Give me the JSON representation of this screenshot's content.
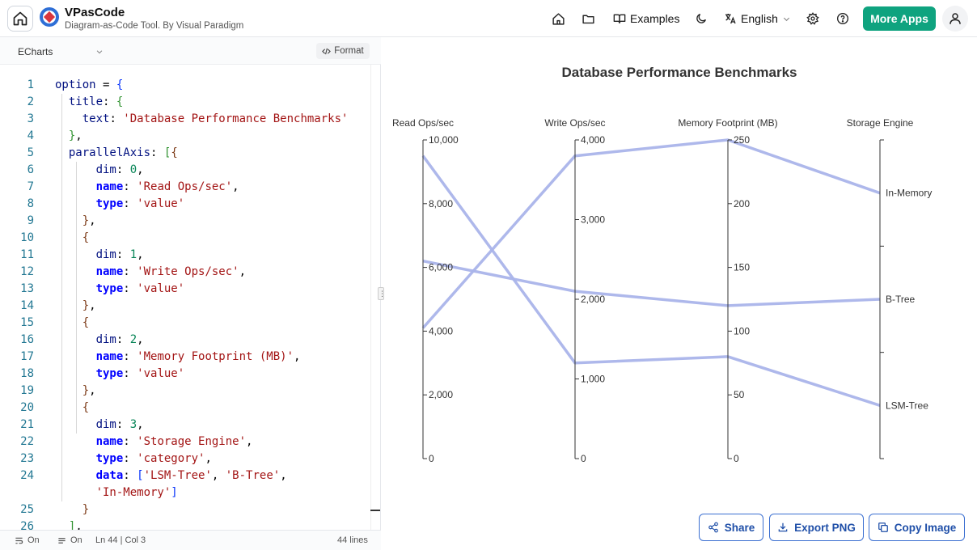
{
  "header": {
    "app_name": "VPasCode",
    "app_subtitle": "Diagram-as-Code Tool. By Visual Paradigm",
    "examples_label": "Examples",
    "language_label": "English",
    "more_apps_label": "More Apps",
    "brand_color": "#0fa37f"
  },
  "editor": {
    "library": "ECharts",
    "format_label": "Format",
    "lines": [
      {
        "n": "1",
        "html": "<span class='k'>option</span> = <span class='b1'>{</span>"
      },
      {
        "n": "2",
        "html": "  <span class='k'>title</span>: <span class='b2'>{</span>"
      },
      {
        "n": "3",
        "html": "    <span class='k'>text</span>: <span class='s'>'Database Performance Benchmarks'</span>"
      },
      {
        "n": "4",
        "html": "  <span class='b2'>}</span>,"
      },
      {
        "n": "5",
        "html": "  <span class='k'>parallelAxis</span>: <span class='b2'>[</span><span class='b3'>{</span>"
      },
      {
        "n": "6",
        "html": "      <span class='k'>dim</span>: <span class='n'>0</span>,"
      },
      {
        "n": "7",
        "html": "      <span class='kb'>name</span>: <span class='s'>'Read Ops/sec'</span>,"
      },
      {
        "n": "8",
        "html": "      <span class='kb'>type</span>: <span class='s'>'value'</span>"
      },
      {
        "n": "9",
        "html": "    <span class='b3'>}</span>,"
      },
      {
        "n": "10",
        "html": "    <span class='b3'>{</span>"
      },
      {
        "n": "11",
        "html": "      <span class='k'>dim</span>: <span class='n'>1</span>,"
      },
      {
        "n": "12",
        "html": "      <span class='kb'>name</span>: <span class='s'>'Write Ops/sec'</span>,"
      },
      {
        "n": "13",
        "html": "      <span class='kb'>type</span>: <span class='s'>'value'</span>"
      },
      {
        "n": "14",
        "html": "    <span class='b3'>}</span>,"
      },
      {
        "n": "15",
        "html": "    <span class='b3'>{</span>"
      },
      {
        "n": "16",
        "html": "      <span class='k'>dim</span>: <span class='n'>2</span>,"
      },
      {
        "n": "17",
        "html": "      <span class='kb'>name</span>: <span class='s'>'Memory Footprint (MB)'</span>,"
      },
      {
        "n": "18",
        "html": "      <span class='kb'>type</span>: <span class='s'>'value'</span>"
      },
      {
        "n": "19",
        "html": "    <span class='b3'>}</span>,"
      },
      {
        "n": "20",
        "html": "    <span class='b3'>{</span>"
      },
      {
        "n": "21",
        "html": "      <span class='k'>dim</span>: <span class='n'>3</span>,"
      },
      {
        "n": "22",
        "html": "      <span class='kb'>name</span>: <span class='s'>'Storage Engine'</span>,"
      },
      {
        "n": "23",
        "html": "      <span class='kb'>type</span>: <span class='s'>'category'</span>,"
      },
      {
        "n": "24",
        "html": "      <span class='kb'>data</span>: <span class='b1'>[</span><span class='s'>'LSM-Tree'</span>, <span class='s'>'B-Tree'</span>,"
      },
      {
        "n": "",
        "html": "      <span class='s'>'In-Memory'</span><span class='b1'>]</span>"
      },
      {
        "n": "25",
        "html": "    <span class='b3'>}</span>"
      },
      {
        "n": "26",
        "html": "  <span class='b2'>]</span>,"
      }
    ]
  },
  "status": {
    "wrap": "On",
    "minimap": "On",
    "cursor": "Ln 44 | Col 3",
    "total_lines": "44 lines"
  },
  "actions": {
    "share": "Share",
    "export_png": "Export PNG",
    "copy_image": "Copy Image"
  },
  "chart_data": {
    "type": "parallel",
    "title": "Database Performance Benchmarks",
    "axes": [
      {
        "name": "Read Ops/sec",
        "type": "value",
        "min": 0,
        "max": 10000,
        "ticks": [
          "0",
          "2,000",
          "4,000",
          "6,000",
          "8,000",
          "10,000"
        ],
        "tick_values": [
          0,
          2000,
          4000,
          6000,
          8000,
          10000
        ]
      },
      {
        "name": "Write Ops/sec",
        "type": "value",
        "min": 0,
        "max": 4000,
        "ticks": [
          "0",
          "1,000",
          "2,000",
          "3,000",
          "4,000"
        ],
        "tick_values": [
          0,
          1000,
          2000,
          3000,
          4000
        ]
      },
      {
        "name": "Memory Footprint (MB)",
        "type": "value",
        "min": 0,
        "max": 250,
        "ticks": [
          "0",
          "50",
          "100",
          "150",
          "200",
          "250"
        ],
        "tick_values": [
          0,
          50,
          100,
          150,
          200,
          250
        ]
      },
      {
        "name": "Storage Engine",
        "type": "category",
        "categories": [
          "LSM-Tree",
          "B-Tree",
          "In-Memory"
        ]
      }
    ],
    "series": [
      {
        "values": [
          9500,
          1200,
          80,
          "LSM-Tree"
        ]
      },
      {
        "values": [
          6200,
          2100,
          120,
          "B-Tree"
        ]
      },
      {
        "values": [
          4100,
          3800,
          250,
          "In-Memory"
        ]
      }
    ],
    "line_color": "#aab4ea"
  }
}
